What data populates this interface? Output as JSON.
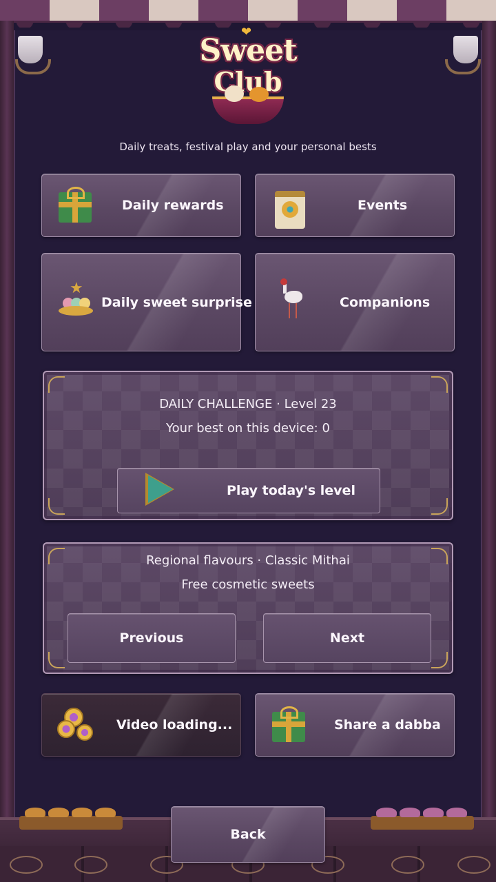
{
  "logo": {
    "line1": "Sweet",
    "line2": "Club"
  },
  "subtitle": "Daily treats, festival play and your personal bests",
  "menu": {
    "daily_rewards": "Daily rewards",
    "events": "Events",
    "daily_sweet_surprise": "Daily sweet surprise",
    "companions": "Companions"
  },
  "daily_challenge": {
    "title": "DAILY CHALLENGE · Level 23",
    "best": "Your best on this device: 0",
    "play_label": "Play today's level"
  },
  "regional": {
    "title": "Regional flavours · Classic Mithai",
    "subtitle": "Free cosmetic sweets",
    "previous_label": "Previous",
    "next_label": "Next"
  },
  "bottom_actions": {
    "video_label": "Video loading...",
    "share_label": "Share a dabba"
  },
  "back_label": "Back",
  "colors": {
    "background": "#1f1733",
    "button_fill": "#5b4863",
    "button_border": "#a08ea8",
    "accent_gold": "#d8a53a",
    "gift_green": "#3f8b4a",
    "play_teal": "#3e9f8c"
  },
  "icons": {
    "daily_rewards": "gift-icon",
    "events": "calendar-flower-icon",
    "daily_sweet_surprise": "sweet-plate-star-icon",
    "companions": "stork-icon",
    "play": "play-icon",
    "video": "coins-icon",
    "share": "gift-icon"
  }
}
